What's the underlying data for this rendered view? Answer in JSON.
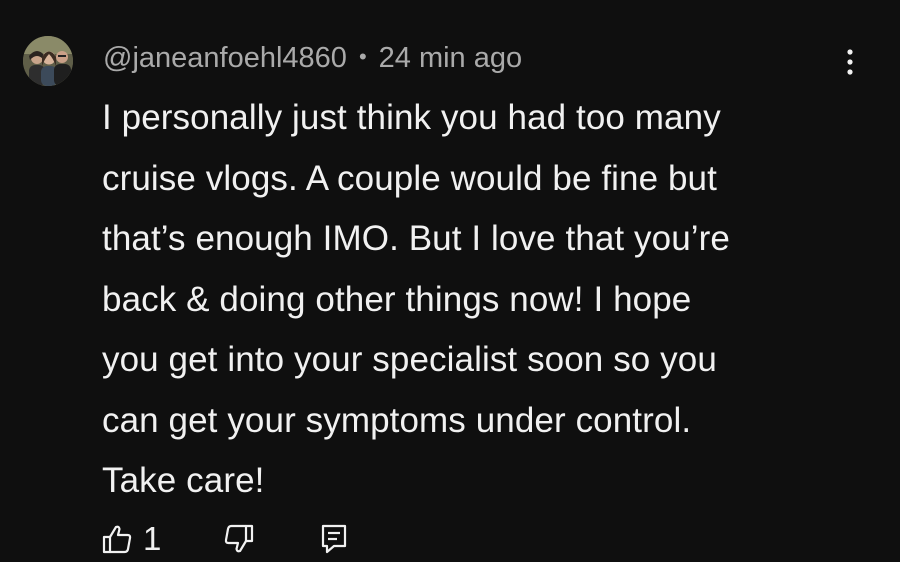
{
  "comment": {
    "author": "@janeanfoehl4860",
    "separator": "•",
    "timestamp": "24 min ago",
    "text_lines": [
      "I personally just think you had too many",
      "cruise vlogs. A couple would be fine but",
      "that’s enough IMO. But I love that you’re",
      "back & doing other things now! I hope",
      "you get into your specialist soon so you",
      "can get your symptoms under control.",
      "Take care!"
    ],
    "like_count": "1"
  },
  "icons": {
    "avatar": "avatar-photo",
    "more": "more-vertical-icon",
    "like": "thumbs-up-icon",
    "dislike": "thumbs-down-icon",
    "reply": "reply-comment-icon"
  },
  "colors": {
    "background": "#0f0f0f",
    "text_primary": "#f1f1f1",
    "text_secondary": "#aaaaaa"
  }
}
